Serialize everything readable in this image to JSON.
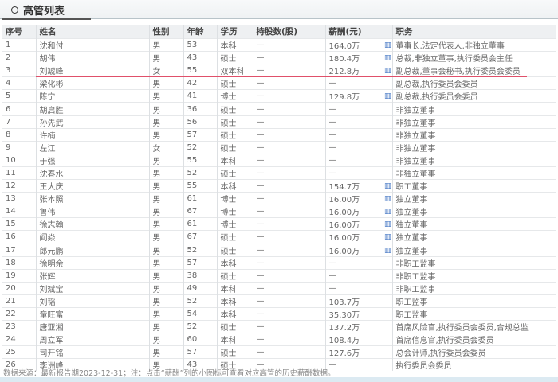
{
  "title": "高管列表",
  "columns": [
    "序号",
    "姓名",
    "性别",
    "年龄",
    "学历",
    "持股数(股)",
    "薪酬(元)",
    "职务"
  ],
  "rows": [
    [
      "1",
      "沈和付",
      "男",
      "53",
      "本科",
      "—",
      "164.0万",
      true,
      "董事长,法定代表人,非独立董事"
    ],
    [
      "2",
      "胡伟",
      "男",
      "43",
      "硕士",
      "—",
      "180.4万",
      true,
      "总裁,非独立董事,执行委员会主任"
    ],
    [
      "3",
      "刘虓峰",
      "女",
      "55",
      "双本科",
      "—",
      "212.8万",
      true,
      "副总裁,董事会秘书,执行委员会委员"
    ],
    [
      "4",
      "梁化彬",
      "男",
      "42",
      "硕士",
      "—",
      "—",
      false,
      "副总裁,执行委员会委员"
    ],
    [
      "5",
      "陈宁",
      "男",
      "41",
      "博士",
      "—",
      "129.8万",
      true,
      "副总裁,执行委员会委员"
    ],
    [
      "6",
      "胡启胜",
      "男",
      "36",
      "硕士",
      "—",
      "—",
      false,
      "非独立董事"
    ],
    [
      "7",
      "孙先武",
      "男",
      "56",
      "硕士",
      "—",
      "—",
      false,
      "非独立董事"
    ],
    [
      "8",
      "许楠",
      "男",
      "57",
      "硕士",
      "—",
      "—",
      false,
      "非独立董事"
    ],
    [
      "9",
      "左江",
      "女",
      "52",
      "硕士",
      "—",
      "—",
      false,
      "非独立董事"
    ],
    [
      "10",
      "于强",
      "男",
      "55",
      "本科",
      "—",
      "—",
      false,
      "非独立董事"
    ],
    [
      "11",
      "沈春水",
      "男",
      "52",
      "硕士",
      "—",
      "—",
      false,
      "非独立董事"
    ],
    [
      "12",
      "王大庆",
      "男",
      "55",
      "本科",
      "—",
      "154.7万",
      true,
      "职工董事"
    ],
    [
      "13",
      "张本照",
      "男",
      "61",
      "博士",
      "—",
      "16.00万",
      true,
      "独立董事"
    ],
    [
      "14",
      "鲁伟",
      "男",
      "67",
      "博士",
      "—",
      "16.00万",
      true,
      "独立董事"
    ],
    [
      "15",
      "徐志翰",
      "男",
      "61",
      "博士",
      "—",
      "16.00万",
      true,
      "独立董事"
    ],
    [
      "16",
      "阎焱",
      "男",
      "67",
      "硕士",
      "—",
      "16.00万",
      true,
      "独立董事"
    ],
    [
      "17",
      "郎元鹏",
      "男",
      "52",
      "硕士",
      "—",
      "16.00万",
      true,
      "独立董事"
    ],
    [
      "18",
      "徐明余",
      "男",
      "57",
      "本科",
      "—",
      "—",
      false,
      "非职工监事"
    ],
    [
      "19",
      "张辉",
      "男",
      "38",
      "硕士",
      "—",
      "—",
      false,
      "非职工监事"
    ],
    [
      "20",
      "刘斌宝",
      "男",
      "49",
      "本科",
      "—",
      "—",
      false,
      "非职工监事"
    ],
    [
      "21",
      "刘韬",
      "男",
      "52",
      "本科",
      "—",
      "103.7万",
      false,
      "职工监事"
    ],
    [
      "22",
      "童旺富",
      "男",
      "54",
      "本科",
      "—",
      "35.30万",
      false,
      "职工监事"
    ],
    [
      "23",
      "唐亚湘",
      "男",
      "52",
      "硕士",
      "—",
      "137.2万",
      false,
      "首席风险官,执行委员会委员,合规总监"
    ],
    [
      "24",
      "周立军",
      "男",
      "60",
      "本科",
      "—",
      "108.4万",
      false,
      "首席信息官,执行委员会委员"
    ],
    [
      "25",
      "司开铭",
      "男",
      "57",
      "硕士",
      "—",
      "127.6万",
      false,
      "总会计师,执行委员会委员"
    ],
    [
      "26",
      "李洲峰",
      "男",
      "43",
      "硕士",
      "—",
      "—",
      false,
      "执行委员会委员"
    ]
  ],
  "chart_icon": "bar-chart-icon",
  "footer": "数据来源：最新报告期2023-12-31；注：点击“薪酬”列的小图标可查看对应高管的历史薪酬数据。"
}
